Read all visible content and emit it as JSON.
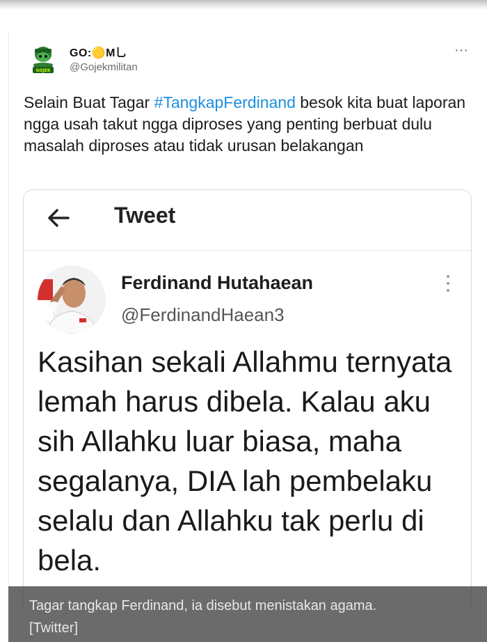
{
  "tweet": {
    "display_name": "GO:🟡M乚",
    "handle": "@Gojekmilitan",
    "text_before_hashtag": "Selain Buat Tagar ",
    "hashtag": "#TangkapFerdinand",
    "text_after_hashtag": "  besok kita buat laporan ngga usah takut ngga diproses yang penting berbuat dulu masalah diproses atau tidak urusan belakangan",
    "more_icon": "more-horizontal-icon"
  },
  "embedded": {
    "title": "Tweet",
    "back_icon": "arrow-left-icon",
    "author_name": "Ferdinand Hutahaean",
    "author_handle": "@FerdinandHaean3",
    "more_icon": "more-vertical-icon",
    "text": "Kasihan sekali Allahmu ternyata lemah harus dibela. Kalau aku sih Allahku luar biasa, maha segalanya, DIA lah pembelaku selalu dan Allahku tak perlu di bela."
  },
  "caption": {
    "line1": "Tagar tangkap Ferdinand, ia disebut menistakan agama.",
    "line2": "[Twitter]"
  },
  "colors": {
    "hashtag": "#1d8fe0",
    "caption_bg": "#464646"
  }
}
